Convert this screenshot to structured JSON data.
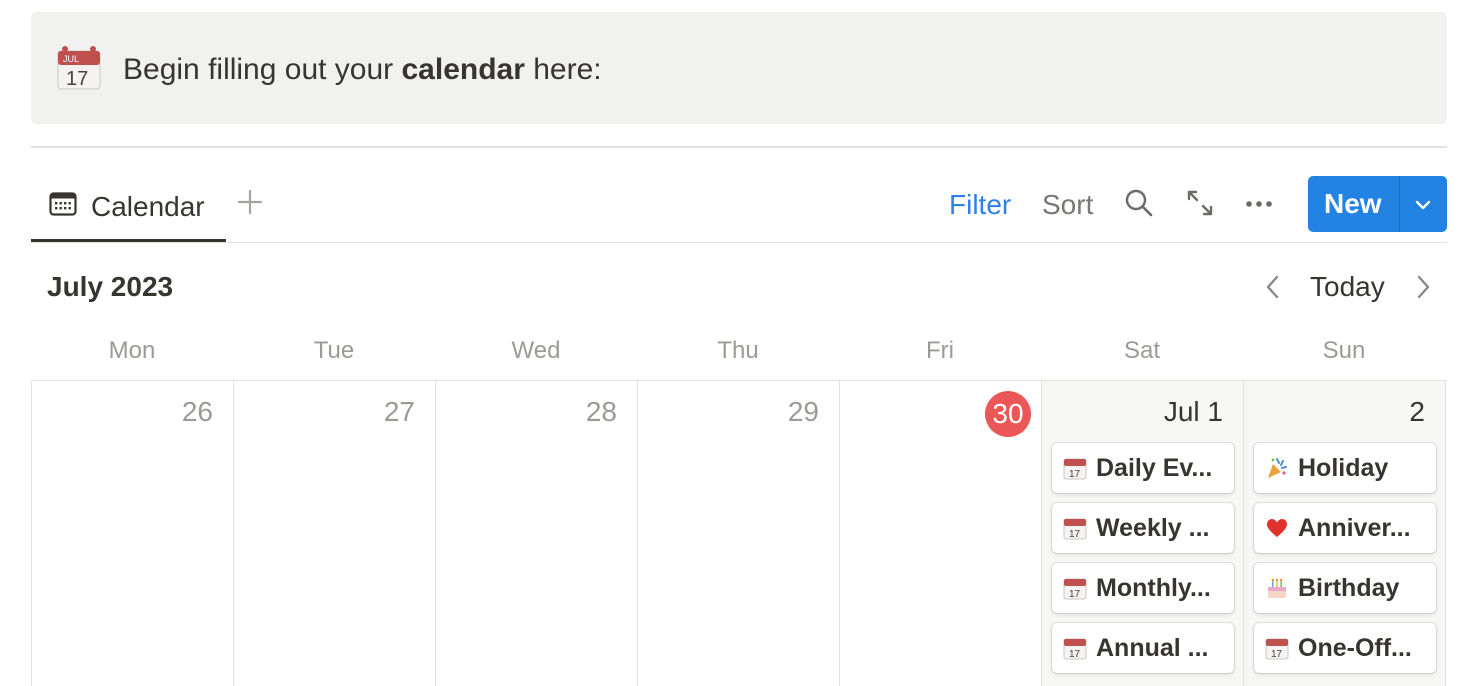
{
  "callout": {
    "icon": "calendar-icon",
    "icon_month": "JUL",
    "icon_day": "17",
    "text_before": "Begin filling out your ",
    "text_bold": "calendar",
    "text_after": " here:"
  },
  "view_tabs": [
    {
      "label": "Calendar",
      "icon": "calendar-grid-icon",
      "active": true
    }
  ],
  "toolbar": {
    "filter_label": "Filter",
    "sort_label": "Sort",
    "search_icon": "search-icon",
    "expand_icon": "expand-icon",
    "more_icon": "more-icon",
    "new_label": "New"
  },
  "calendar": {
    "month_label": "July 2023",
    "today_label": "Today",
    "weekdays": [
      "Mon",
      "Tue",
      "Wed",
      "Thu",
      "Fri",
      "Sat",
      "Sun"
    ],
    "days": [
      {
        "label": "26",
        "today": false,
        "weekend": false,
        "events": []
      },
      {
        "label": "27",
        "today": false,
        "weekend": false,
        "events": []
      },
      {
        "label": "28",
        "today": false,
        "weekend": false,
        "events": []
      },
      {
        "label": "29",
        "today": false,
        "weekend": false,
        "events": []
      },
      {
        "label": "30",
        "today": true,
        "weekend": false,
        "events": []
      },
      {
        "label": "Jul 1",
        "today": false,
        "weekend": true,
        "events": [
          {
            "title": "Daily Ev...",
            "icon": "calendar-icon"
          },
          {
            "title": "Weekly ...",
            "icon": "calendar-icon"
          },
          {
            "title": "Monthly...",
            "icon": "calendar-icon"
          },
          {
            "title": "Annual ...",
            "icon": "calendar-icon"
          }
        ]
      },
      {
        "label": "2",
        "today": false,
        "weekend": true,
        "events": [
          {
            "title": "Holiday",
            "icon": "party-popper-icon"
          },
          {
            "title": "Anniver...",
            "icon": "heart-icon"
          },
          {
            "title": "Birthday",
            "icon": "cake-icon"
          },
          {
            "title": "One-Off...",
            "icon": "calendar-icon"
          }
        ]
      }
    ]
  },
  "colors": {
    "accent": "#2383e2",
    "filter_text": "#2f80ed",
    "today_badge": "#eb5757",
    "callout_bg": "#f1f1ef",
    "weekend_bg": "#f7f7f5"
  }
}
